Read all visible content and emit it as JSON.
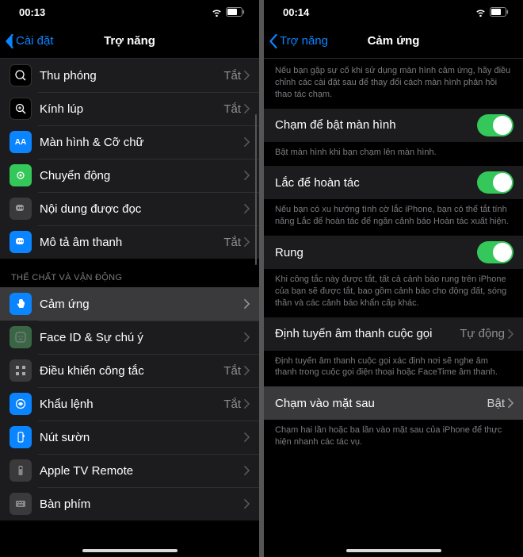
{
  "left": {
    "time": "00:13",
    "back": "Cài đặt",
    "title": "Trợ năng",
    "value_off": "Tắt",
    "rows": [
      {
        "label": "Thu phóng",
        "value": "Tắt"
      },
      {
        "label": "Kính lúp",
        "value": "Tắt"
      },
      {
        "label": "Màn hình & Cỡ chữ"
      },
      {
        "label": "Chuyển động"
      },
      {
        "label": "Nội dung được đọc"
      },
      {
        "label": "Mô tả âm thanh",
        "value": "Tắt"
      }
    ],
    "section2_header": "THỂ CHẤT VÀ VẬN ĐỘNG",
    "rows2": [
      {
        "label": "Cảm ứng"
      },
      {
        "label": "Face ID & Sự chú ý"
      },
      {
        "label": "Điều khiển công tắc",
        "value": "Tắt"
      },
      {
        "label": "Khẩu lệnh",
        "value": "Tắt"
      },
      {
        "label": "Nút sườn"
      },
      {
        "label": "Apple TV Remote"
      },
      {
        "label": "Bàn phím"
      }
    ]
  },
  "right": {
    "time": "00:14",
    "back": "Trợ năng",
    "title": "Cảm ứng",
    "intro": "Nếu bạn gặp sự cố khi sử dụng màn hình cảm ứng, hãy điều chỉnh các cài đặt sau để thay đổi cách màn hình phản hồi thao tác chạm.",
    "tap_to_wake": "Chạm để bật màn hình",
    "tap_to_wake_footer": "Bật màn hình khi bạn chạm lên màn hình.",
    "shake_undo": "Lắc để hoàn tác",
    "shake_undo_footer": "Nếu bạn có xu hướng tình cờ lắc iPhone, bạn có thể tắt tính năng Lắc để hoàn tác để ngăn cảnh báo Hoàn tác xuất hiện.",
    "vibration": "Rung",
    "vibration_footer": "Khi công tắc này được tắt, tất cả cảnh báo rung trên iPhone của bạn sẽ được tắt, bao gồm cảnh báo cho động đất, sóng thần và các cảnh báo khẩn cấp khác.",
    "call_routing": "Định tuyến âm thanh cuộc gọi",
    "call_routing_value": "Tự động",
    "call_routing_footer": "Định tuyến âm thanh cuộc gọi xác định nơi sẽ nghe âm thanh trong cuộc gọi điện thoại hoặc FaceTime âm thanh.",
    "back_tap": "Chạm vào mặt sau",
    "back_tap_value": "Bật",
    "back_tap_footer": "Chạm hai lần hoặc ba lần vào mặt sau của iPhone để thực hiện nhanh các tác vụ."
  }
}
